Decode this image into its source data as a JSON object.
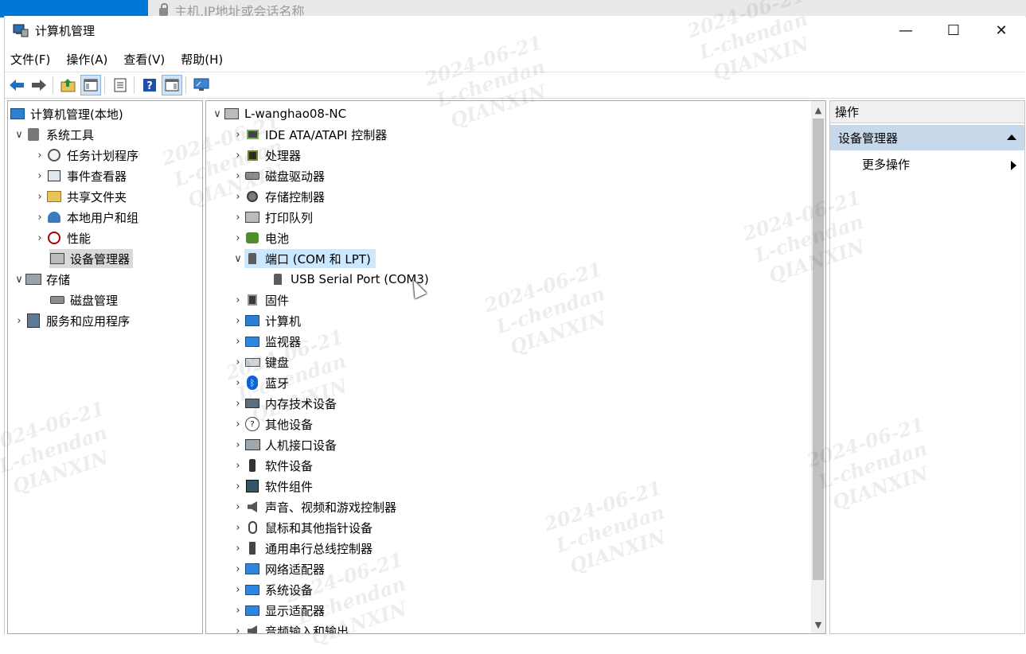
{
  "background": {
    "address_placeholder": "主机,IP地址或会话名称"
  },
  "window": {
    "title": "计算机管理",
    "controls": {
      "minimize": "—",
      "maximize": "☐",
      "close": "✕"
    }
  },
  "menu": [
    "文件(F)",
    "操作(A)",
    "查看(V)",
    "帮助(H)"
  ],
  "toolbar": {
    "icons": [
      "back-arrow-icon",
      "forward-arrow-icon",
      "up-folder-icon",
      "show-hide-console-tree-icon",
      "properties-icon",
      "help-icon",
      "show-hide-action-pane-icon",
      "monitor-icon"
    ]
  },
  "left_tree": {
    "root": "计算机管理(本地)",
    "system_tools": "系统工具",
    "task_scheduler": "任务计划程序",
    "event_viewer": "事件查看器",
    "shared_folders": "共享文件夹",
    "local_users": "本地用户和组",
    "performance": "性能",
    "device_manager": "设备管理器",
    "storage": "存储",
    "disk_management": "磁盘管理",
    "services_apps": "服务和应用程序"
  },
  "device_tree": {
    "computer": "L-wanghao08-NC",
    "categories": [
      "IDE ATA/ATAPI 控制器",
      "处理器",
      "磁盘驱动器",
      "存储控制器",
      "打印队列",
      "电池",
      "端口 (COM 和 LPT)",
      "固件",
      "计算机",
      "监视器",
      "键盘",
      "蓝牙",
      "内存技术设备",
      "其他设备",
      "人机接口设备",
      "软件设备",
      "软件组件",
      "声音、视频和游戏控制器",
      "鼠标和其他指针设备",
      "通用串行总线控制器",
      "网络适配器",
      "系统设备",
      "显示适配器",
      "音频输入和输出"
    ],
    "port_child": "USB Serial Port (COM3)"
  },
  "actions": {
    "header": "操作",
    "group": "设备管理器",
    "more": "更多操作"
  },
  "watermark": {
    "date": "2024-06-21",
    "user": "L-chendan",
    "org": "QIANXIN"
  }
}
